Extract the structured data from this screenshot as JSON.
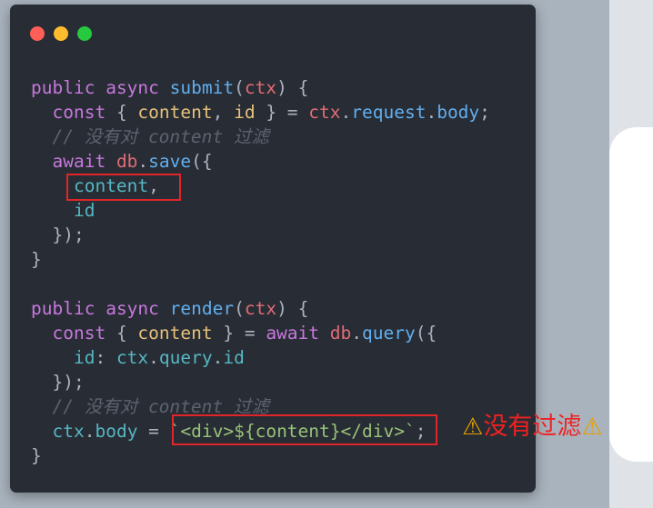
{
  "window": {
    "dots": [
      "close",
      "minimize",
      "maximize"
    ]
  },
  "code": {
    "l1": {
      "kw1": "public",
      "kw2": "async",
      "fn": "submit",
      "p1": "(",
      "param": "ctx",
      "p2": ") {"
    },
    "l2": {
      "kw": "const",
      "p1": "{ ",
      "v1": "content",
      "p2": ", ",
      "v2": "id",
      "p3": " } = ",
      "obj": "ctx",
      "dot1": ".",
      "prop1": "request",
      "dot2": ".",
      "prop2": "body",
      "end": ";"
    },
    "l3": {
      "comment": "// 没有对 content 过滤"
    },
    "l4": {
      "kw": "await",
      "obj": "db",
      "dot": ".",
      "fn": "save",
      "p": "({"
    },
    "l5": {
      "v": "content",
      "p": ","
    },
    "l6": {
      "v": "id"
    },
    "l7": {
      "t": "});"
    },
    "l8": {
      "t": "}"
    },
    "l9": {
      "t": ""
    },
    "l10": {
      "kw1": "public",
      "kw2": "async",
      "fn": "render",
      "p1": "(",
      "param": "ctx",
      "p2": ") {"
    },
    "l11": {
      "kw": "const",
      "p1": "{ ",
      "v1": "content",
      "p2": " } = ",
      "kw2": "await",
      "obj": "db",
      "dot": ".",
      "fn": "query",
      "p3": "({"
    },
    "l12": {
      "key": "id",
      "p1": ": ",
      "obj": "ctx",
      "dot1": ".",
      "prop": "query",
      "dot2": ".",
      "v": "id"
    },
    "l13": {
      "t": "});"
    },
    "l14": {
      "comment": "// 没有对 content 过滤"
    },
    "l15": {
      "obj": "ctx",
      "dot": ".",
      "prop": "body",
      "eq": " = ",
      "tpl": "`<div>${content}</div>`",
      "end": ";"
    },
    "l16": {
      "t": "}"
    }
  },
  "annotation": {
    "warning_icon": "warning-icon",
    "text": "没有过滤"
  },
  "colors": {
    "editor_bg": "#282c34",
    "highlight_box": "#e0262a",
    "annotation_text": "#ee2222"
  }
}
